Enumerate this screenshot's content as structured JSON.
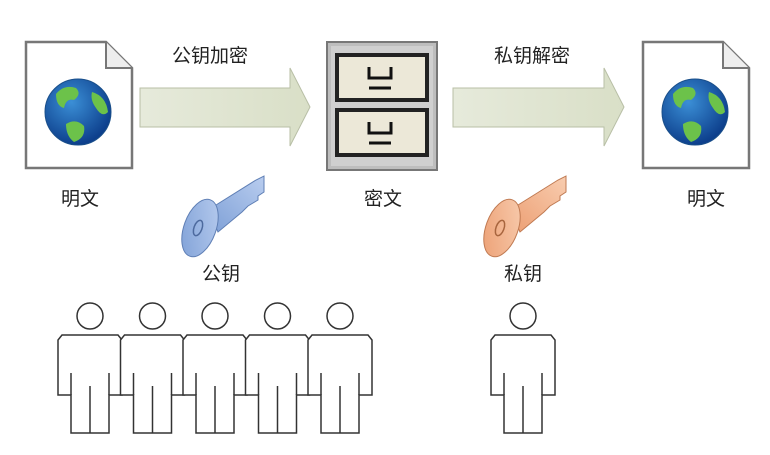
{
  "labels": {
    "encrypt_arrow": "公钥加密",
    "decrypt_arrow": "私钥解密",
    "plaintext_left": "明文",
    "ciphertext": "密文",
    "plaintext_right": "明文",
    "public_key": "公钥",
    "private_key": "私钥"
  },
  "colors": {
    "arrow_fill": "#dfe4cf",
    "public_key": "#8fb0e0",
    "private_key": "#f0b08a",
    "cabinet_drawer": "#ece8d8"
  },
  "public_key_holders": 5,
  "private_key_holders": 1
}
